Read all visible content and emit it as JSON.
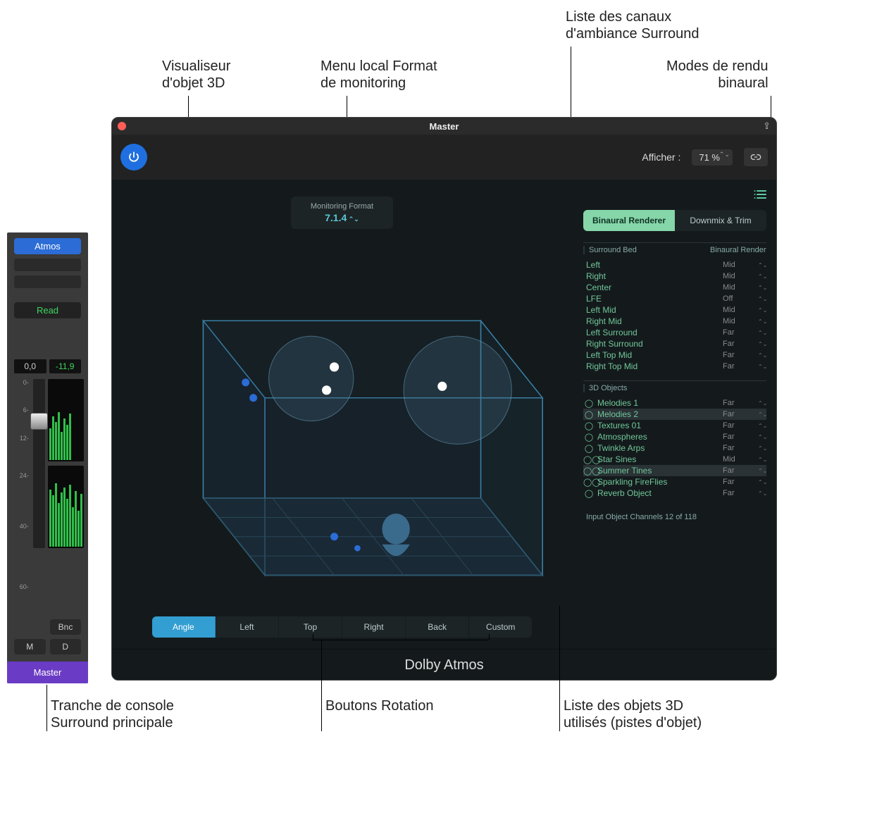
{
  "callouts": {
    "visualiser": "Visualiseur\nd'objet 3D",
    "monitoring": "Menu local Format\nde monitoring",
    "surround_list": "Liste des canaux\nd'ambiance Surround",
    "binaural_modes": "Modes de rendu\nbinaural",
    "channel_strip": "Tranche de console\nSurround principale",
    "rotation": "Boutons Rotation",
    "objects_list": "Liste des objets 3D\nutilisés (pistes d'objet)"
  },
  "channel_strip": {
    "atmos": "Atmos",
    "read": "Read",
    "level_left": "0,0",
    "level_right": "-11,9",
    "scale_ticks": [
      "0",
      "6",
      "12",
      "24",
      "40",
      "60"
    ],
    "meter_ticks": [
      "0",
      "6",
      "12",
      "24",
      "40",
      "60"
    ],
    "bnc": "Bnc",
    "m": "M",
    "d": "D",
    "master": "Master"
  },
  "plugin": {
    "title": "Master",
    "afficher_label": "Afficher :",
    "zoom": "71 %",
    "monitoring_label": "Monitoring Format",
    "monitoring_value": "7.1.4",
    "rotation": [
      "Angle",
      "Left",
      "Top",
      "Right",
      "Back",
      "Custom"
    ],
    "rotation_active": 0,
    "modes": [
      "Binaural Renderer",
      "Downmix & Trim"
    ],
    "modes_active": 0,
    "headers_bed": "Surround Bed",
    "headers_render": "Binaural Render",
    "bed": [
      {
        "name": "Left",
        "render": "Mid"
      },
      {
        "name": "Right",
        "render": "Mid"
      },
      {
        "name": "Center",
        "render": "Mid"
      },
      {
        "name": "LFE",
        "render": "Off"
      },
      {
        "name": "Left Mid",
        "render": "Mid"
      },
      {
        "name": "Right Mid",
        "render": "Mid"
      },
      {
        "name": "Left Surround",
        "render": "Far"
      },
      {
        "name": "Right Surround",
        "render": "Far"
      },
      {
        "name": "Left Top Mid",
        "render": "Far"
      },
      {
        "name": "Right Top Mid",
        "render": "Far"
      }
    ],
    "objects_header": "3D Objects",
    "objects": [
      {
        "name": "Melodies 1",
        "render": "Far",
        "mono": true,
        "sel": false
      },
      {
        "name": "Melodies 2",
        "render": "Far",
        "mono": true,
        "sel": true
      },
      {
        "name": "Textures 01",
        "render": "Far",
        "mono": true,
        "sel": false
      },
      {
        "name": "Atmospheres",
        "render": "Far",
        "mono": true,
        "sel": false
      },
      {
        "name": "Twinkle Arps",
        "render": "Far",
        "mono": true,
        "sel": false
      },
      {
        "name": "Star Sines",
        "render": "Mid",
        "mono": false,
        "sel": false
      },
      {
        "name": "Summer Tines",
        "render": "Far",
        "mono": false,
        "sel": true
      },
      {
        "name": "Sparkling FireFlies",
        "render": "Far",
        "mono": false,
        "sel": false
      },
      {
        "name": "Reverb Object",
        "render": "Far",
        "mono": true,
        "sel": false
      }
    ],
    "objects_footer": "Input Object Channels 12 of 118",
    "footer": "Dolby Atmos"
  }
}
